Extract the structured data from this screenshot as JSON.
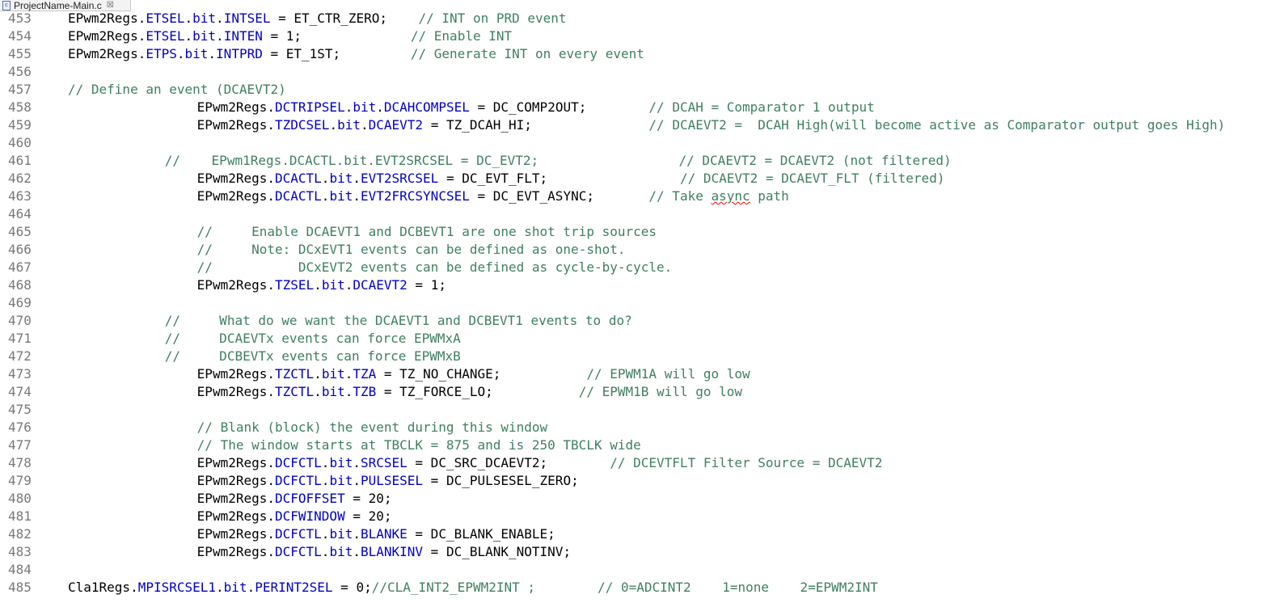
{
  "tab": {
    "file_icon": "c",
    "title": "ProjectName-Main.c",
    "close_glyph": "☒"
  },
  "editor": {
    "lines": [
      {
        "num": "453",
        "indent": 0,
        "tokens": [
          [
            "p",
            "EPwm2Regs."
          ],
          [
            "f",
            "ETSEL"
          ],
          [
            "p",
            "."
          ],
          [
            "f",
            "bit"
          ],
          [
            "p",
            "."
          ],
          [
            "f",
            "INTSEL"
          ],
          [
            "p",
            " = ET_CTR_ZERO;    "
          ],
          [
            "c",
            "// INT on PRD event"
          ]
        ]
      },
      {
        "num": "454",
        "indent": 0,
        "tokens": [
          [
            "p",
            "EPwm2Regs."
          ],
          [
            "f",
            "ETSEL"
          ],
          [
            "p",
            "."
          ],
          [
            "f",
            "bit"
          ],
          [
            "p",
            "."
          ],
          [
            "f",
            "INTEN"
          ],
          [
            "p",
            " = 1;              "
          ],
          [
            "c",
            "// Enable INT"
          ]
        ]
      },
      {
        "num": "455",
        "indent": 0,
        "tokens": [
          [
            "p",
            "EPwm2Regs."
          ],
          [
            "f",
            "ETPS"
          ],
          [
            "p",
            "."
          ],
          [
            "f",
            "bit"
          ],
          [
            "p",
            "."
          ],
          [
            "f",
            "INTPRD"
          ],
          [
            "p",
            " = ET_1ST;         "
          ],
          [
            "c",
            "// Generate INT on every event"
          ]
        ]
      },
      {
        "num": "456",
        "indent": 0,
        "tokens": []
      },
      {
        "num": "457",
        "indent": 0,
        "tokens": [
          [
            "c",
            "// Define an event (DCAEVT2)"
          ]
        ]
      },
      {
        "num": "458",
        "indent": 16,
        "tokens": [
          [
            "p",
            "EPwm2Regs."
          ],
          [
            "f",
            "DCTRIPSEL"
          ],
          [
            "p",
            "."
          ],
          [
            "f",
            "bit"
          ],
          [
            "p",
            "."
          ],
          [
            "f",
            "DCAHCOMPSEL"
          ],
          [
            "p",
            " = DC_COMP2OUT;        "
          ],
          [
            "c",
            "// DCAH = Comparator 1 output"
          ]
        ]
      },
      {
        "num": "459",
        "indent": 16,
        "tokens": [
          [
            "p",
            "EPwm2Regs."
          ],
          [
            "f",
            "TZDCSEL"
          ],
          [
            "p",
            "."
          ],
          [
            "f",
            "bit"
          ],
          [
            "p",
            "."
          ],
          [
            "f",
            "DCAEVT2"
          ],
          [
            "p",
            " = TZ_DCAH_HI;               "
          ],
          [
            "c",
            "// DCAEVT2 =  DCAH High(will become active as Comparator output goes High)"
          ]
        ]
      },
      {
        "num": "460",
        "indent": 0,
        "tokens": []
      },
      {
        "num": "461",
        "indent": 12,
        "tokens": [
          [
            "c",
            "//    EPwm1Regs.DCACTL.bit.EVT2SRCSEL = DC_EVT2;                  // DCAEVT2 = DCAEVT2 (not filtered)"
          ]
        ]
      },
      {
        "num": "462",
        "indent": 16,
        "tokens": [
          [
            "p",
            "EPwm2Regs."
          ],
          [
            "f",
            "DCACTL"
          ],
          [
            "p",
            "."
          ],
          [
            "f",
            "bit"
          ],
          [
            "p",
            "."
          ],
          [
            "f",
            "EVT2SRCSEL"
          ],
          [
            "p",
            " = DC_EVT_FLT;                 "
          ],
          [
            "c",
            "// DCAEVT2 = DCAEVT_FLT (filtered)"
          ]
        ]
      },
      {
        "num": "463",
        "indent": 16,
        "tokens": [
          [
            "p",
            "EPwm2Regs."
          ],
          [
            "f",
            "DCACTL"
          ],
          [
            "p",
            "."
          ],
          [
            "f",
            "bit"
          ],
          [
            "p",
            "."
          ],
          [
            "f",
            "EVT2FRCSYNCSEL"
          ],
          [
            "p",
            " = DC_EVT_ASYNC;       "
          ],
          [
            "c",
            "// Take "
          ],
          [
            "s",
            "async"
          ],
          [
            "c",
            " path"
          ]
        ]
      },
      {
        "num": "464",
        "indent": 0,
        "tokens": []
      },
      {
        "num": "465",
        "indent": 16,
        "tokens": [
          [
            "c",
            "//     Enable DCAEVT1 and DCBEVT1 are one shot trip sources"
          ]
        ]
      },
      {
        "num": "466",
        "indent": 16,
        "tokens": [
          [
            "c",
            "//     Note: DCxEVT1 events can be defined as one-shot."
          ]
        ]
      },
      {
        "num": "467",
        "indent": 16,
        "tokens": [
          [
            "c",
            "//           DCxEVT2 events can be defined as cycle-by-cycle."
          ]
        ]
      },
      {
        "num": "468",
        "indent": 16,
        "tokens": [
          [
            "p",
            "EPwm2Regs."
          ],
          [
            "f",
            "TZSEL"
          ],
          [
            "p",
            "."
          ],
          [
            "f",
            "bit"
          ],
          [
            "p",
            "."
          ],
          [
            "f",
            "DCAEVT2"
          ],
          [
            "p",
            " = 1;"
          ]
        ]
      },
      {
        "num": "469",
        "indent": 0,
        "tokens": []
      },
      {
        "num": "470",
        "indent": 12,
        "tokens": [
          [
            "c",
            "//     What do we want the DCAEVT1 and DCBEVT1 events to do?"
          ]
        ]
      },
      {
        "num": "471",
        "indent": 12,
        "tokens": [
          [
            "c",
            "//     DCAEVTx events can force EPWMxA"
          ]
        ]
      },
      {
        "num": "472",
        "indent": 12,
        "tokens": [
          [
            "c",
            "//     DCBEVTx events can force EPWMxB"
          ]
        ]
      },
      {
        "num": "473",
        "indent": 16,
        "tokens": [
          [
            "p",
            "EPwm2Regs."
          ],
          [
            "f",
            "TZCTL"
          ],
          [
            "p",
            "."
          ],
          [
            "f",
            "bit"
          ],
          [
            "p",
            "."
          ],
          [
            "f",
            "TZA"
          ],
          [
            "p",
            " = TZ_NO_CHANGE;           "
          ],
          [
            "c",
            "// EPWM1A will go low"
          ]
        ]
      },
      {
        "num": "474",
        "indent": 16,
        "tokens": [
          [
            "p",
            "EPwm2Regs."
          ],
          [
            "f",
            "TZCTL"
          ],
          [
            "p",
            "."
          ],
          [
            "f",
            "bit"
          ],
          [
            "p",
            "."
          ],
          [
            "f",
            "TZB"
          ],
          [
            "p",
            " = TZ_FORCE_LO;           "
          ],
          [
            "c",
            "// EPWM1B will go low"
          ]
        ]
      },
      {
        "num": "475",
        "indent": 0,
        "tokens": []
      },
      {
        "num": "476",
        "indent": 16,
        "tokens": [
          [
            "c",
            "// Blank (block) the event during this window"
          ]
        ]
      },
      {
        "num": "477",
        "indent": 16,
        "tokens": [
          [
            "c",
            "// The window starts at TBCLK = 875 and is 250 TBCLK wide"
          ]
        ]
      },
      {
        "num": "478",
        "indent": 16,
        "tokens": [
          [
            "p",
            "EPwm2Regs."
          ],
          [
            "f",
            "DCFCTL"
          ],
          [
            "p",
            "."
          ],
          [
            "f",
            "bit"
          ],
          [
            "p",
            "."
          ],
          [
            "f",
            "SRCSEL"
          ],
          [
            "p",
            " = DC_SRC_DCAEVT2;        "
          ],
          [
            "c",
            "// DCEVTFLT Filter Source = DCAEVT2"
          ]
        ]
      },
      {
        "num": "479",
        "indent": 16,
        "tokens": [
          [
            "p",
            "EPwm2Regs."
          ],
          [
            "f",
            "DCFCTL"
          ],
          [
            "p",
            "."
          ],
          [
            "f",
            "bit"
          ],
          [
            "p",
            "."
          ],
          [
            "f",
            "PULSESEL"
          ],
          [
            "p",
            " = DC_PULSESEL_ZERO;"
          ]
        ]
      },
      {
        "num": "480",
        "indent": 16,
        "tokens": [
          [
            "p",
            "EPwm2Regs."
          ],
          [
            "f",
            "DCFOFFSET"
          ],
          [
            "p",
            " = 20;"
          ]
        ]
      },
      {
        "num": "481",
        "indent": 16,
        "tokens": [
          [
            "p",
            "EPwm2Regs."
          ],
          [
            "f",
            "DCFWINDOW"
          ],
          [
            "p",
            " = 20;"
          ]
        ]
      },
      {
        "num": "482",
        "indent": 16,
        "tokens": [
          [
            "p",
            "EPwm2Regs."
          ],
          [
            "f",
            "DCFCTL"
          ],
          [
            "p",
            "."
          ],
          [
            "f",
            "bit"
          ],
          [
            "p",
            "."
          ],
          [
            "f",
            "BLANKE"
          ],
          [
            "p",
            " = DC_BLANK_ENABLE;"
          ]
        ]
      },
      {
        "num": "483",
        "indent": 16,
        "tokens": [
          [
            "p",
            "EPwm2Regs."
          ],
          [
            "f",
            "DCFCTL"
          ],
          [
            "p",
            "."
          ],
          [
            "f",
            "bit"
          ],
          [
            "p",
            "."
          ],
          [
            "f",
            "BLANKINV"
          ],
          [
            "p",
            " = DC_BLANK_NOTINV;"
          ]
        ]
      },
      {
        "num": "484",
        "indent": 0,
        "tokens": []
      },
      {
        "num": "485",
        "indent": 0,
        "tokens": [
          [
            "p",
            "Cla1Regs."
          ],
          [
            "f",
            "MPISRCSEL1"
          ],
          [
            "p",
            "."
          ],
          [
            "f",
            "bit"
          ],
          [
            "p",
            "."
          ],
          [
            "f",
            "PERINT2SEL"
          ],
          [
            "p",
            " = 0;"
          ],
          [
            "c",
            "//CLA_INT2_EPWM2INT ;        // 0=ADCINT2    1=none    2=EPWM2INT"
          ]
        ]
      }
    ]
  }
}
